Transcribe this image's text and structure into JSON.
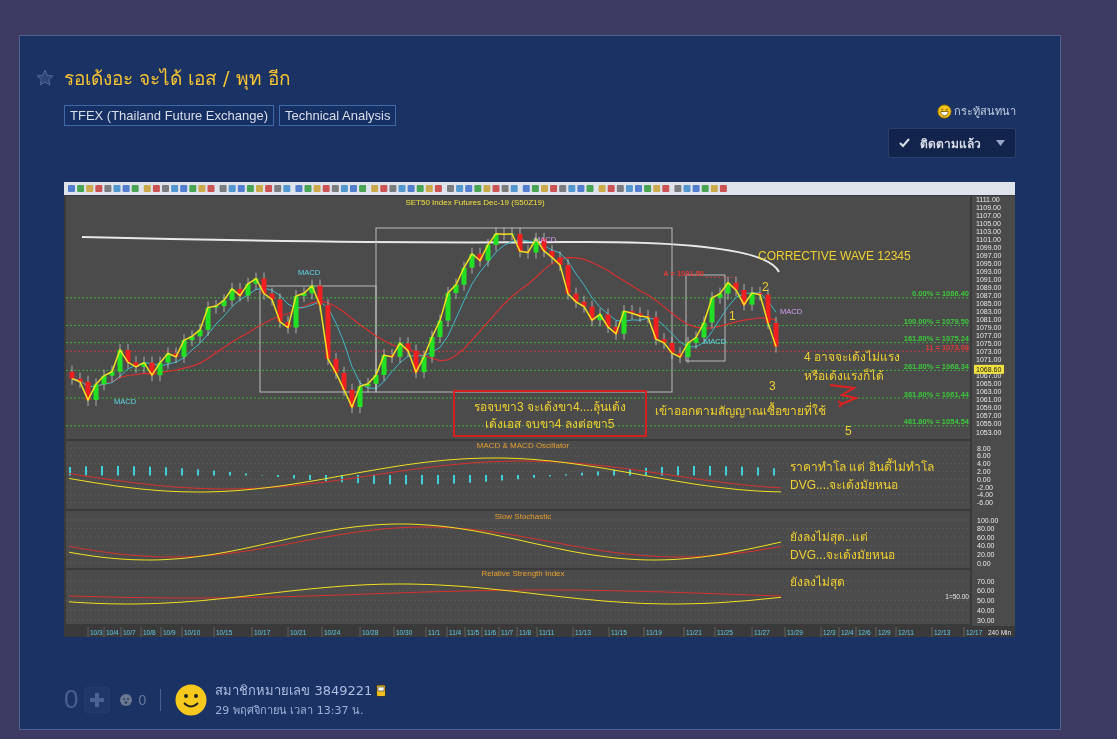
{
  "title": "รอเด้งอะ จะได้ เอส / พุท อีก",
  "starred": false,
  "tags": [
    "TFEX (Thailand Future Exchange)",
    "Technical Analysis"
  ],
  "topic_type": "กระทู้สนทนา",
  "follow_button": {
    "label": "ติดตามแล้ว",
    "followed": true
  },
  "chart": {
    "title": "SET50 Index Futures Dec-19 (S50Z19)",
    "price_axis": [
      "1111.00",
      "1109.00",
      "1107.00",
      "1105.00",
      "1103.00",
      "1101.00",
      "1099.00",
      "1097.00",
      "1095.00",
      "1093.00",
      "1091.00",
      "1089.00",
      "1087.00",
      "1085.00",
      "1083.00",
      "1081.00",
      "1079.00",
      "1077.00",
      "1075.00",
      "1073.00",
      "1071.00",
      "1067.00",
      "1065.00",
      "1063.00",
      "1061.00",
      "1059.00",
      "1057.00",
      "1055.00",
      "1053.00"
    ],
    "current_price": "1068.60",
    "levels": [
      {
        "label": "A = 1091.50",
        "color": "#e03a3a"
      },
      {
        "label": "0.00% = 1086.40",
        "color": "#3cc83c"
      },
      {
        "label": "100.00% = 1079.50",
        "color": "#3cc83c"
      },
      {
        "label": "161.80% = 1075.24",
        "color": "#3cc83c"
      },
      {
        "label": "11 = 1073.08",
        "color": "#e03a3a"
      },
      {
        "label": "261.80% = 1068.34",
        "color": "#3cc83c"
      },
      {
        "label": "361.80% = 1061.44",
        "color": "#3cc83c"
      },
      {
        "label": "461.80% = 1054.54",
        "color": "#3cc83c"
      }
    ],
    "markers": [
      "MACD",
      "MACD",
      "MACD",
      "MACD",
      "MACD"
    ],
    "annotations": [
      {
        "kind": "label",
        "lines": [
          "CORRECTIVE WAVE 12345"
        ]
      },
      {
        "kind": "label",
        "lines": [
          "2"
        ]
      },
      {
        "kind": "label",
        "lines": [
          "1"
        ]
      },
      {
        "kind": "label",
        "lines": [
          "4 อาจจะเด้งไม่แรง",
          "หรือเด้งแรงก็ได้"
        ]
      },
      {
        "kind": "label",
        "lines": [
          "3"
        ]
      },
      {
        "kind": "boxed",
        "lines": [
          "รอจบขา3 จะเด้งขา4....ลุ้นเด้ง",
          "เด้งเอส จบขา4 ลงต่อขา5"
        ]
      },
      {
        "kind": "label",
        "lines": [
          "เข้าออกตามสัญญาณเซื้อขายที่ใช้"
        ]
      },
      {
        "kind": "label",
        "lines": [
          "5"
        ]
      }
    ],
    "panels": [
      {
        "title": "MACD & MACD Oscillator",
        "axis": [
          "8.00",
          "6.00",
          "4.00",
          "2.00",
          "0.00",
          "-2.00",
          "-4.00",
          "-6.00"
        ],
        "note": [
          "ราคาทำโล แต่ อินดี้ไม่ทำโล",
          "DVG....จะเด้งมัยหนอ"
        ]
      },
      {
        "title": "Slow Stochastic",
        "axis": [
          "100.00",
          "80.00",
          "60.00",
          "40.00",
          "20.00",
          "0.00"
        ],
        "note": [
          "ยังลงไม่สุด..แต่",
          "DVG...จะเด้งมัยหนอ"
        ]
      },
      {
        "title": "Relative Strength Index",
        "axis": [
          "70.00",
          "60.00",
          "50.00",
          "40.00",
          "30.00"
        ],
        "note": [
          "ยังลงไม่สุด"
        ],
        "reference": "1=50.00"
      }
    ],
    "dates": [
      "10/3",
      "10/4",
      "10/7",
      "10/8",
      "10/9",
      "10/10",
      "10/15",
      "10/17",
      "10/21",
      "10/24",
      "10/28",
      "10/30",
      "11/1",
      "11/4",
      "11/5",
      "11/6",
      "11/7",
      "11/8",
      "11/11",
      "11/13",
      "11/15",
      "11/19",
      "11/21",
      "11/25",
      "11/27",
      "11/29",
      "12/3",
      "12/4",
      "12/6",
      "12/9",
      "12/11",
      "12/13",
      "12/17"
    ],
    "timeframe": "240 Min"
  },
  "footer": {
    "votes": "0",
    "reactions": "0",
    "author": "สมาชิกหมายเลข 3849221",
    "date": "29 พฤศจิกายน เวลา 13:37 น."
  }
}
